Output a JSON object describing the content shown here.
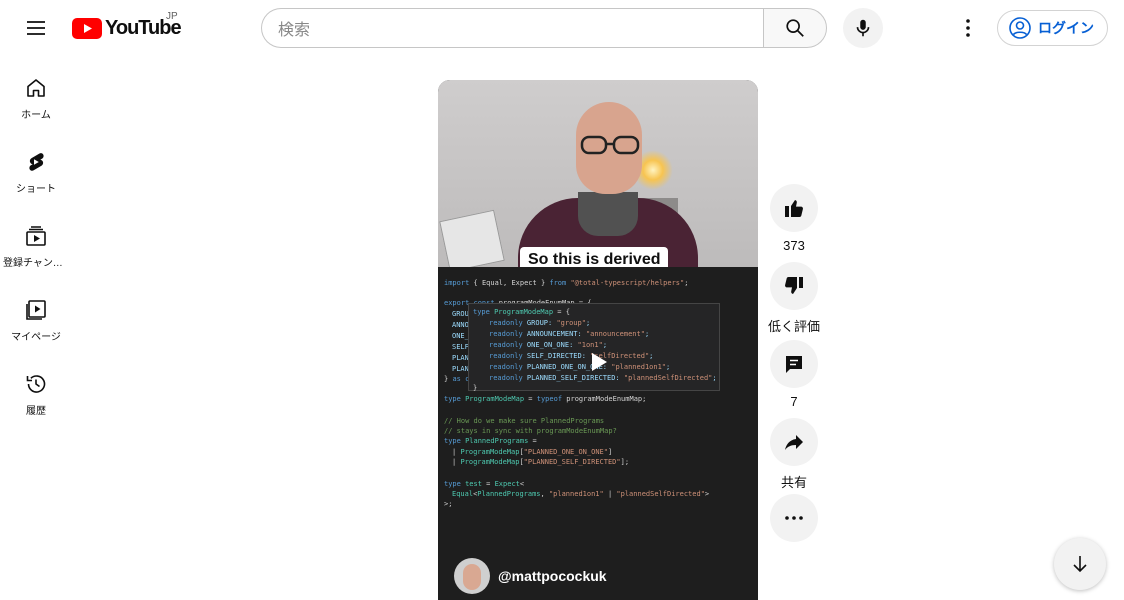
{
  "header": {
    "logo_text": "YouTube",
    "region": "JP",
    "search_placeholder": "検索",
    "login_label": "ログイン"
  },
  "sidebar": {
    "items": [
      {
        "label": "ホーム",
        "icon": "home-icon"
      },
      {
        "label": "ショート",
        "icon": "shorts-icon"
      },
      {
        "label": "登録チャンネル",
        "icon": "subscriptions-icon"
      },
      {
        "label": "マイページ",
        "icon": "library-icon"
      },
      {
        "label": "履歴",
        "icon": "history-icon"
      }
    ]
  },
  "video": {
    "caption": "So this is derived",
    "channel": "@mattpocockuk"
  },
  "actions": {
    "like_count": "373",
    "dislike_label": "低く評価",
    "comment_count": "7",
    "share_label": "共有"
  },
  "colors": {
    "brand_red": "#ff0000",
    "link_blue": "#065fd4"
  }
}
